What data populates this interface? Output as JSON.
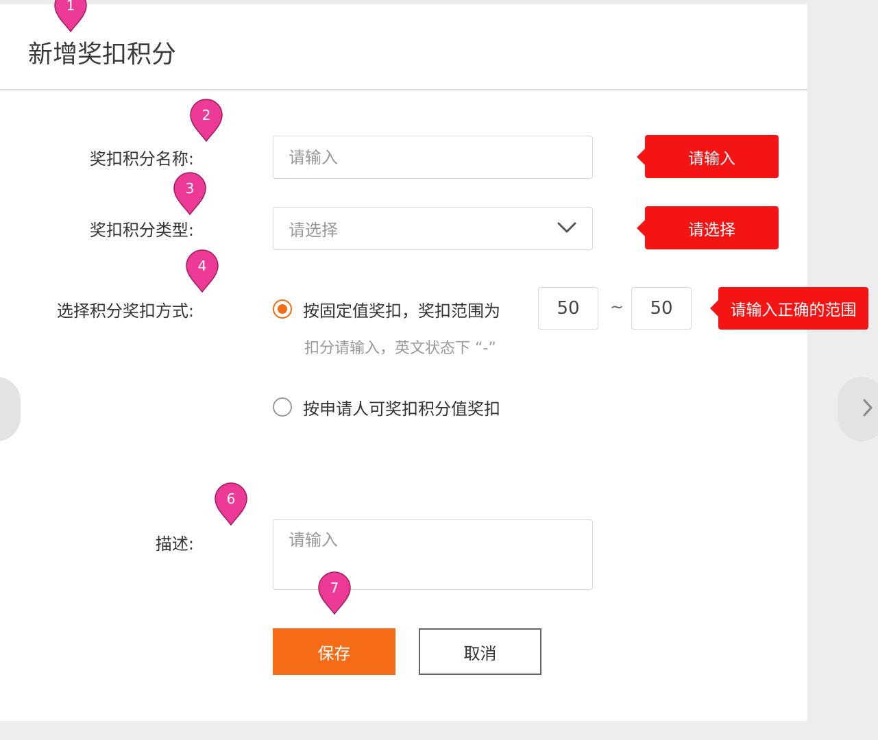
{
  "page": {
    "title": "新增奖扣积分"
  },
  "form": {
    "name": {
      "label": "奖扣积分名称:",
      "placeholder": "请输入",
      "error": "请输入"
    },
    "type": {
      "label": "奖扣积分类型:",
      "placeholder": "请选择",
      "error": "请选择"
    },
    "method": {
      "label": "选择积分奖扣方式:",
      "option_fixed": "按固定值奖扣，奖扣范围为",
      "range_min": "50",
      "range_separator": "~",
      "range_max": "50",
      "range_hint": "扣分请输入，英文状态下 “-”",
      "range_error": "请输入正确的范围",
      "option_applicant": "按申请人可奖扣积分值奖扣",
      "selected": "fixed"
    },
    "description": {
      "label": "描述:",
      "placeholder": "请输入"
    },
    "buttons": {
      "save": "保存",
      "cancel": "取消"
    }
  },
  "markers": [
    "1",
    "2",
    "3",
    "4",
    "6",
    "7"
  ],
  "colors": {
    "accent": "#f56b16",
    "error": "#f51414",
    "marker": "#ee3a97"
  }
}
